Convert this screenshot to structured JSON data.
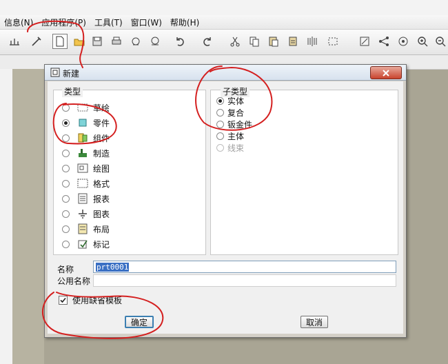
{
  "menubar": {
    "items": [
      "信息(N)",
      "应用程序(P)",
      "工具(T)",
      "窗口(W)",
      "帮助(H)"
    ]
  },
  "toolbar": {
    "icons": [
      "measure-icon",
      "regen-icon",
      "new-file-icon",
      "open-folder-icon",
      "save-icon",
      "print-icon",
      "print-preview-icon",
      "send-icon",
      "undo-icon",
      "redo-icon",
      "cut-icon",
      "copy-icon",
      "paste-icon",
      "paste-special-icon",
      "mirror-icon",
      "select-box-icon",
      "sketch-icon",
      "relations-icon",
      "model-tree-icon",
      "zoom-in-icon",
      "zoom-out-icon"
    ]
  },
  "dialog": {
    "title": "新建",
    "type_group_label": "类型",
    "types": [
      {
        "label": "草绘",
        "icon": "sketch-icon",
        "checked": false
      },
      {
        "label": "零件",
        "icon": "part-icon",
        "checked": true
      },
      {
        "label": "组件",
        "icon": "assembly-icon",
        "checked": false
      },
      {
        "label": "制造",
        "icon": "manufacturing-icon",
        "checked": false
      },
      {
        "label": "绘图",
        "icon": "drawing-icon",
        "checked": false
      },
      {
        "label": "格式",
        "icon": "format-icon",
        "checked": false
      },
      {
        "label": "报表",
        "icon": "report-icon",
        "checked": false
      },
      {
        "label": "图表",
        "icon": "diagram-icon",
        "checked": false
      },
      {
        "label": "布局",
        "icon": "layout-icon",
        "checked": false
      },
      {
        "label": "标记",
        "icon": "markup-icon",
        "checked": false
      }
    ],
    "subtype_group_label": "子类型",
    "subtypes": [
      {
        "label": "实体",
        "checked": true,
        "disabled": false
      },
      {
        "label": "复合",
        "checked": false,
        "disabled": false
      },
      {
        "label": "钣金件",
        "checked": false,
        "disabled": false
      },
      {
        "label": "主体",
        "checked": false,
        "disabled": false
      },
      {
        "label": "线束",
        "checked": false,
        "disabled": true
      }
    ],
    "name_label": "名称",
    "name_value": "prt0001",
    "common_name_label": "公用名称",
    "common_name_value": "",
    "default_template_label": "使用缺省模板",
    "default_template_checked": true,
    "ok_label": "确定",
    "cancel_label": "取消"
  },
  "colors": {
    "annotation": "#d41f1f",
    "selection": "#3a70c4",
    "close_button": "#c9432d"
  }
}
